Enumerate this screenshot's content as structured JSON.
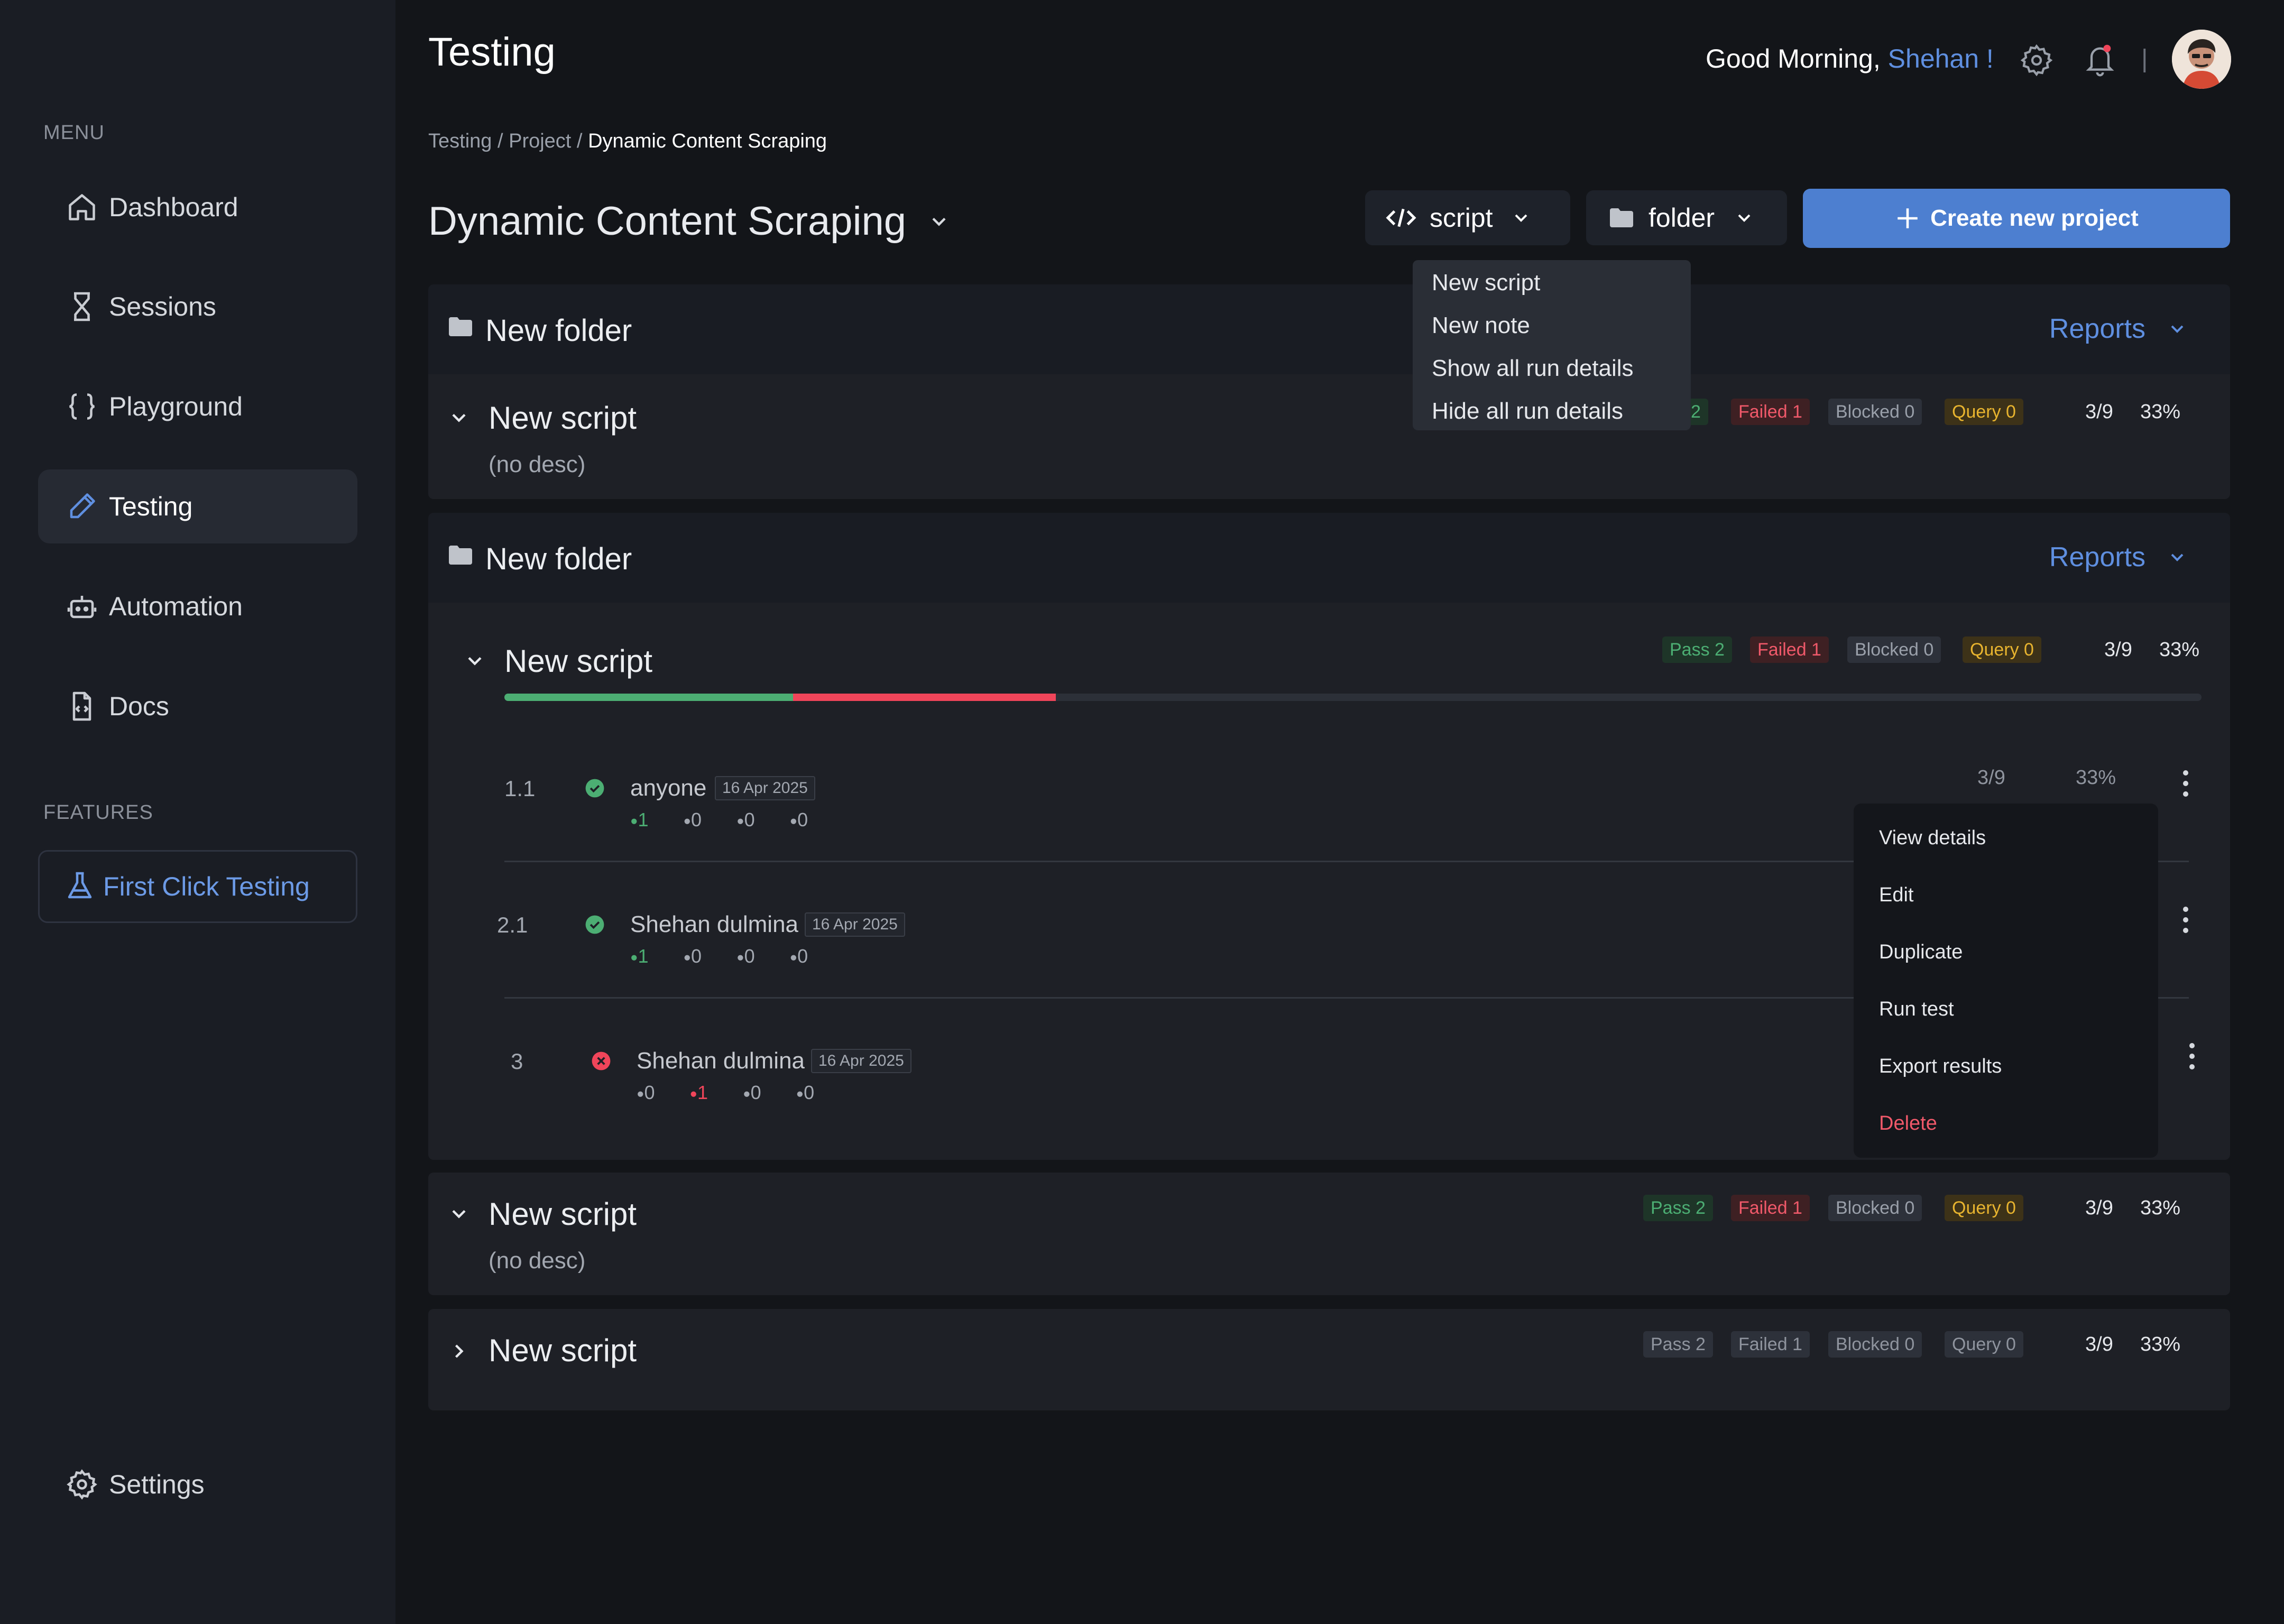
{
  "sidebar": {
    "menu_label": "MENU",
    "items": [
      {
        "label": "Dashboard",
        "icon": "home-icon"
      },
      {
        "label": "Sessions",
        "icon": "hourglass-icon"
      },
      {
        "label": "Playground",
        "icon": "braces-icon"
      },
      {
        "label": "Testing",
        "icon": "pen-icon",
        "active": true
      },
      {
        "label": "Automation",
        "icon": "robot-icon"
      },
      {
        "label": "Docs",
        "icon": "code-file-icon"
      }
    ],
    "features_label": "FEATURES",
    "feature_item": {
      "label": "First Click Testing",
      "icon": "flask-icon"
    },
    "settings_label": "Settings"
  },
  "header": {
    "title": "Testing",
    "greeting": "Good Morning,",
    "user_name": "Shehan !",
    "separator": "|"
  },
  "breadcrumb": {
    "part1": "Testing",
    "sep1": " / ",
    "part2": "Project",
    "sep2": " / ",
    "current": "Dynamic Content Scraping"
  },
  "project": {
    "title": "Dynamic Content Scraping"
  },
  "toolbar": {
    "script_btn": "script",
    "folder_btn": "folder",
    "create_btn": "Create new project"
  },
  "script_dropdown": [
    "New script",
    "New note",
    "Show all run details",
    "Hide all run details"
  ],
  "folders": [
    {
      "name": "New folder",
      "reports": "Reports"
    },
    {
      "name": "New folder",
      "reports": "Reports"
    }
  ],
  "scripts": [
    {
      "title": "New script",
      "desc": "(no desc)",
      "pass": "2",
      "failed": "Failed 1",
      "blocked": "Blocked 0",
      "query": "Query 0",
      "ratio": "3/9",
      "pct": "33%"
    },
    {
      "title": "New script",
      "pass": "Pass 2",
      "failed": "Failed 1",
      "blocked": "Blocked 0",
      "query": "Query 0",
      "ratio": "3/9",
      "pct": "33%"
    },
    {
      "title": "New script",
      "desc": "(no desc)",
      "pass": "Pass 2",
      "failed": "Failed 1",
      "blocked": "Blocked 0",
      "query": "Query 0",
      "ratio": "3/9",
      "pct": "33%"
    },
    {
      "title": "New script",
      "pass": "Pass 2",
      "failed": "Failed 1",
      "blocked": "Blocked 0",
      "query": "Query 0",
      "ratio": "3/9",
      "pct": "33%"
    }
  ],
  "progress": {
    "pass_fraction": 0.17,
    "fail_fraction": 0.155
  },
  "runs": [
    {
      "num": "1.1",
      "name": "anyone",
      "date": "16 Apr 2025",
      "status": "pass",
      "counts": [
        "1",
        "0",
        "0",
        "0"
      ],
      "ratio": "3/9",
      "pct": "33%"
    },
    {
      "num": "2.1",
      "name": "Shehan dulmina",
      "date": "16 Apr 2025",
      "status": "pass",
      "counts": [
        "1",
        "0",
        "0",
        "0"
      ]
    },
    {
      "num": "3",
      "name": "Shehan dulmina",
      "date": "16 Apr 2025",
      "status": "fail",
      "counts": [
        "0",
        "1",
        "0",
        "0"
      ]
    }
  ],
  "context_menu": [
    "View details",
    "Edit",
    "Duplicate",
    "Run test",
    "Export results",
    "Delete"
  ],
  "colors": {
    "accent": "#4d7fd0",
    "pass": "#4cae73",
    "fail": "#f0455a",
    "query": "#e8b42f",
    "bg": "#131519",
    "sidebar": "#1a1d24"
  }
}
